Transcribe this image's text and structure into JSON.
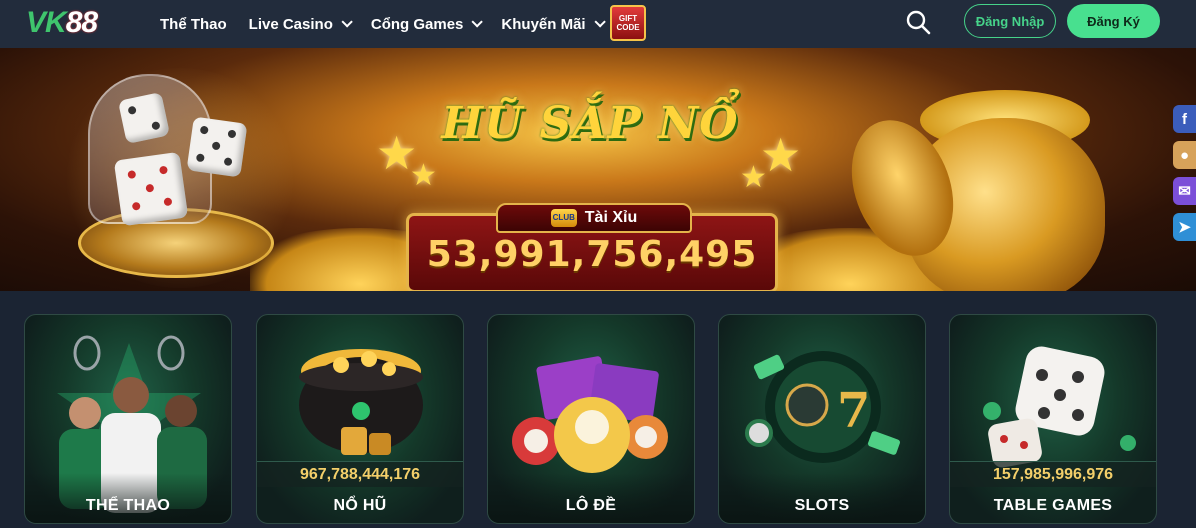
{
  "header": {
    "logo_letters": "VK",
    "logo_number": "88",
    "nav": [
      {
        "label": "Thể Thao",
        "dropdown": false
      },
      {
        "label": "Live Casino",
        "dropdown": true
      },
      {
        "label": "Cổng Games",
        "dropdown": true
      },
      {
        "label": "Khuyến Mãi",
        "dropdown": true
      }
    ],
    "gift_line1": "GIFT",
    "gift_line2": "CODE",
    "login_label": "Đăng Nhập",
    "register_label": "Đăng Ký"
  },
  "banner": {
    "title": "HŨ SẮP NỔ",
    "game_label": "Tài Xỉu",
    "club_badge": "CLUB",
    "jackpot_amount": "53,991,756,495",
    "slide_count": 2,
    "active_slide": 1
  },
  "social": [
    {
      "name": "facebook-icon",
      "glyph": "f",
      "color": "#3b5dbb"
    },
    {
      "name": "community-icon",
      "glyph": "●",
      "color": "#d7a25a"
    },
    {
      "name": "messenger-icon",
      "glyph": "✉",
      "color": "#7b4fd8"
    },
    {
      "name": "telegram-icon",
      "glyph": "➤",
      "color": "#2f8fd6"
    }
  ],
  "cards": [
    {
      "label": "THỂ THAO",
      "amount": ""
    },
    {
      "label": "NỔ HŨ",
      "amount": "967,788,444,176"
    },
    {
      "label": "LÔ ĐỀ",
      "amount": ""
    },
    {
      "label": "SLOTS",
      "amount": ""
    },
    {
      "label": "TABLE GAMES",
      "amount": "157,985,996,976"
    }
  ],
  "colors": {
    "accent_green": "#46d38a",
    "header_bg": "#222c3c",
    "page_bg": "#1b2433",
    "jackpot_gold": "#ffd166"
  }
}
